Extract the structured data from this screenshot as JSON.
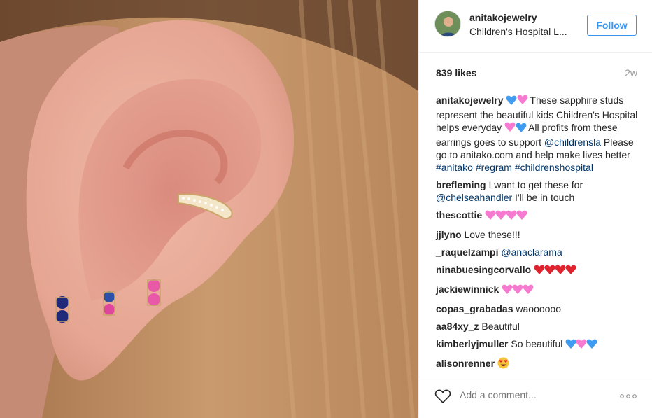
{
  "photo": {
    "alt_icon": "ear-photo"
  },
  "header": {
    "username": "anitakojewelry",
    "location": "Children's Hospital L...",
    "follow_label": "Follow"
  },
  "meta": {
    "likes": "839 likes",
    "age": "2w"
  },
  "caption": {
    "user": "anitakojewelry",
    "text_a": "These sapphire studs represent the beautiful kids Children's Hospital helps everyday ",
    "text_b": "All profits from these earrings goes to support ",
    "mention": "@childrensla",
    "text_c": " Please go to anitako.com and help make lives better ",
    "tag1": "#anitako",
    "tag2": "#regram",
    "tag3": "#childrenshospital"
  },
  "comments": [
    {
      "user": "brefleming",
      "text": "I want to get these for ",
      "mention": "@chelseahandler",
      "text2": " I'll be in touch"
    },
    {
      "user": "thescottie"
    },
    {
      "user": "jjlyno",
      "text": "Love these!!!"
    },
    {
      "user": "_raquelzampi",
      "mention": "@anaclarama"
    },
    {
      "user": "ninabuesingcorvallo"
    },
    {
      "user": "jackiewinnick"
    },
    {
      "user": "copas_grabadas",
      "text": "waoooooo"
    },
    {
      "user": "aa84xy_z",
      "text": "Beautiful"
    },
    {
      "user": "kimberlyjmuller",
      "text": "So beautiful "
    },
    {
      "user": "alisonrenner"
    }
  ],
  "footer": {
    "placeholder": "Add a comment...",
    "more_icon": "ellipsis-icon",
    "like_icon": "heart-icon"
  },
  "colors": {
    "link": "#003569",
    "follow": "#3897f0",
    "muted": "#999999"
  }
}
